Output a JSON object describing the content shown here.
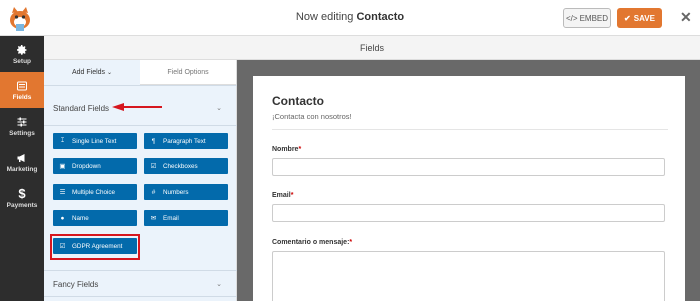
{
  "topbar": {
    "title_prefix": "Now editing ",
    "title_form": "Contacto",
    "embed_label": "EMBED",
    "save_label": "SAVE",
    "accent": "#e27730"
  },
  "sidebar": {
    "items": [
      {
        "label": "Setup",
        "icon": "gear-icon"
      },
      {
        "label": "Fields",
        "icon": "fields-icon",
        "active": true
      },
      {
        "label": "Settings",
        "icon": "sliders-icon"
      },
      {
        "label": "Marketing",
        "icon": "megaphone-icon"
      },
      {
        "label": "Payments",
        "icon": "dollar-icon"
      }
    ]
  },
  "fields_header": "Fields",
  "panel": {
    "tabs": {
      "add": "Add Fields",
      "options": "Field Options"
    },
    "standard_section": "Standard Fields",
    "fancy_section": "Fancy Fields",
    "buttons": [
      {
        "label": "Single Line Text",
        "icon": "text-cursor-icon"
      },
      {
        "label": "Paragraph Text",
        "icon": "paragraph-icon"
      },
      {
        "label": "Dropdown",
        "icon": "dropdown-icon"
      },
      {
        "label": "Checkboxes",
        "icon": "checkbox-icon"
      },
      {
        "label": "Multiple Choice",
        "icon": "list-icon"
      },
      {
        "label": "Numbers",
        "icon": "hash-icon"
      },
      {
        "label": "Name",
        "icon": "user-icon"
      },
      {
        "label": "Email",
        "icon": "envelope-icon"
      },
      {
        "label": "GDPR Agreement",
        "icon": "checkbox-icon"
      }
    ]
  },
  "form": {
    "title": "Contacto",
    "description": "¡Contacta con nosotros!",
    "fields": [
      {
        "label": "Nombre",
        "required_mark": "*"
      },
      {
        "label": "Email",
        "required_mark": "*"
      },
      {
        "label": "Comentario o mensaje:",
        "required_mark": "*"
      }
    ]
  },
  "colors": {
    "button_blue": "#036aab",
    "sidebar_bg": "#2d2d2d",
    "highlight_red": "#d6161e"
  }
}
